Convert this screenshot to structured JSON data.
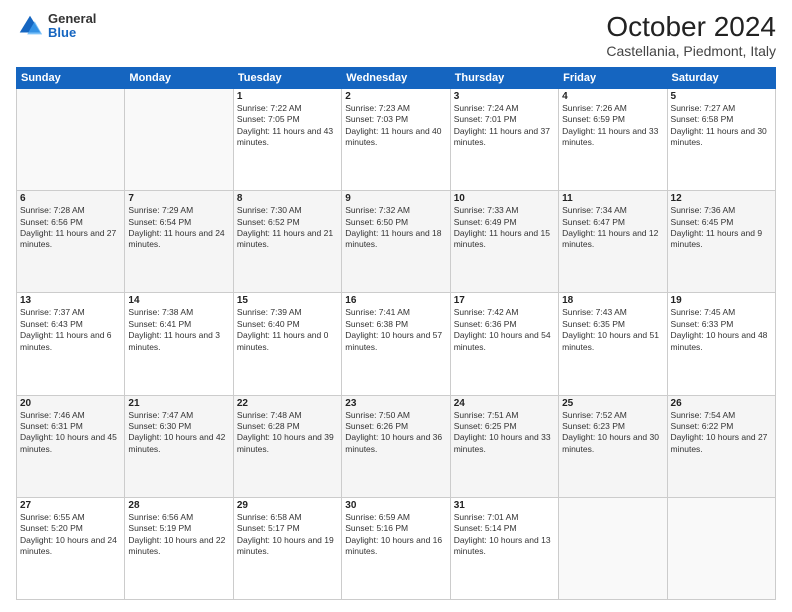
{
  "header": {
    "logo": {
      "general": "General",
      "blue": "Blue"
    },
    "title": "October 2024",
    "subtitle": "Castellania, Piedmont, Italy"
  },
  "days_of_week": [
    "Sunday",
    "Monday",
    "Tuesday",
    "Wednesday",
    "Thursday",
    "Friday",
    "Saturday"
  ],
  "weeks": [
    [
      {
        "day": "",
        "info": ""
      },
      {
        "day": "",
        "info": ""
      },
      {
        "day": "1",
        "info": "Sunrise: 7:22 AM\nSunset: 7:05 PM\nDaylight: 11 hours and 43 minutes."
      },
      {
        "day": "2",
        "info": "Sunrise: 7:23 AM\nSunset: 7:03 PM\nDaylight: 11 hours and 40 minutes."
      },
      {
        "day": "3",
        "info": "Sunrise: 7:24 AM\nSunset: 7:01 PM\nDaylight: 11 hours and 37 minutes."
      },
      {
        "day": "4",
        "info": "Sunrise: 7:26 AM\nSunset: 6:59 PM\nDaylight: 11 hours and 33 minutes."
      },
      {
        "day": "5",
        "info": "Sunrise: 7:27 AM\nSunset: 6:58 PM\nDaylight: 11 hours and 30 minutes."
      }
    ],
    [
      {
        "day": "6",
        "info": "Sunrise: 7:28 AM\nSunset: 6:56 PM\nDaylight: 11 hours and 27 minutes."
      },
      {
        "day": "7",
        "info": "Sunrise: 7:29 AM\nSunset: 6:54 PM\nDaylight: 11 hours and 24 minutes."
      },
      {
        "day": "8",
        "info": "Sunrise: 7:30 AM\nSunset: 6:52 PM\nDaylight: 11 hours and 21 minutes."
      },
      {
        "day": "9",
        "info": "Sunrise: 7:32 AM\nSunset: 6:50 PM\nDaylight: 11 hours and 18 minutes."
      },
      {
        "day": "10",
        "info": "Sunrise: 7:33 AM\nSunset: 6:49 PM\nDaylight: 11 hours and 15 minutes."
      },
      {
        "day": "11",
        "info": "Sunrise: 7:34 AM\nSunset: 6:47 PM\nDaylight: 11 hours and 12 minutes."
      },
      {
        "day": "12",
        "info": "Sunrise: 7:36 AM\nSunset: 6:45 PM\nDaylight: 11 hours and 9 minutes."
      }
    ],
    [
      {
        "day": "13",
        "info": "Sunrise: 7:37 AM\nSunset: 6:43 PM\nDaylight: 11 hours and 6 minutes."
      },
      {
        "day": "14",
        "info": "Sunrise: 7:38 AM\nSunset: 6:41 PM\nDaylight: 11 hours and 3 minutes."
      },
      {
        "day": "15",
        "info": "Sunrise: 7:39 AM\nSunset: 6:40 PM\nDaylight: 11 hours and 0 minutes."
      },
      {
        "day": "16",
        "info": "Sunrise: 7:41 AM\nSunset: 6:38 PM\nDaylight: 10 hours and 57 minutes."
      },
      {
        "day": "17",
        "info": "Sunrise: 7:42 AM\nSunset: 6:36 PM\nDaylight: 10 hours and 54 minutes."
      },
      {
        "day": "18",
        "info": "Sunrise: 7:43 AM\nSunset: 6:35 PM\nDaylight: 10 hours and 51 minutes."
      },
      {
        "day": "19",
        "info": "Sunrise: 7:45 AM\nSunset: 6:33 PM\nDaylight: 10 hours and 48 minutes."
      }
    ],
    [
      {
        "day": "20",
        "info": "Sunrise: 7:46 AM\nSunset: 6:31 PM\nDaylight: 10 hours and 45 minutes."
      },
      {
        "day": "21",
        "info": "Sunrise: 7:47 AM\nSunset: 6:30 PM\nDaylight: 10 hours and 42 minutes."
      },
      {
        "day": "22",
        "info": "Sunrise: 7:48 AM\nSunset: 6:28 PM\nDaylight: 10 hours and 39 minutes."
      },
      {
        "day": "23",
        "info": "Sunrise: 7:50 AM\nSunset: 6:26 PM\nDaylight: 10 hours and 36 minutes."
      },
      {
        "day": "24",
        "info": "Sunrise: 7:51 AM\nSunset: 6:25 PM\nDaylight: 10 hours and 33 minutes."
      },
      {
        "day": "25",
        "info": "Sunrise: 7:52 AM\nSunset: 6:23 PM\nDaylight: 10 hours and 30 minutes."
      },
      {
        "day": "26",
        "info": "Sunrise: 7:54 AM\nSunset: 6:22 PM\nDaylight: 10 hours and 27 minutes."
      }
    ],
    [
      {
        "day": "27",
        "info": "Sunrise: 6:55 AM\nSunset: 5:20 PM\nDaylight: 10 hours and 24 minutes."
      },
      {
        "day": "28",
        "info": "Sunrise: 6:56 AM\nSunset: 5:19 PM\nDaylight: 10 hours and 22 minutes."
      },
      {
        "day": "29",
        "info": "Sunrise: 6:58 AM\nSunset: 5:17 PM\nDaylight: 10 hours and 19 minutes."
      },
      {
        "day": "30",
        "info": "Sunrise: 6:59 AM\nSunset: 5:16 PM\nDaylight: 10 hours and 16 minutes."
      },
      {
        "day": "31",
        "info": "Sunrise: 7:01 AM\nSunset: 5:14 PM\nDaylight: 10 hours and 13 minutes."
      },
      {
        "day": "",
        "info": ""
      },
      {
        "day": "",
        "info": ""
      }
    ]
  ]
}
